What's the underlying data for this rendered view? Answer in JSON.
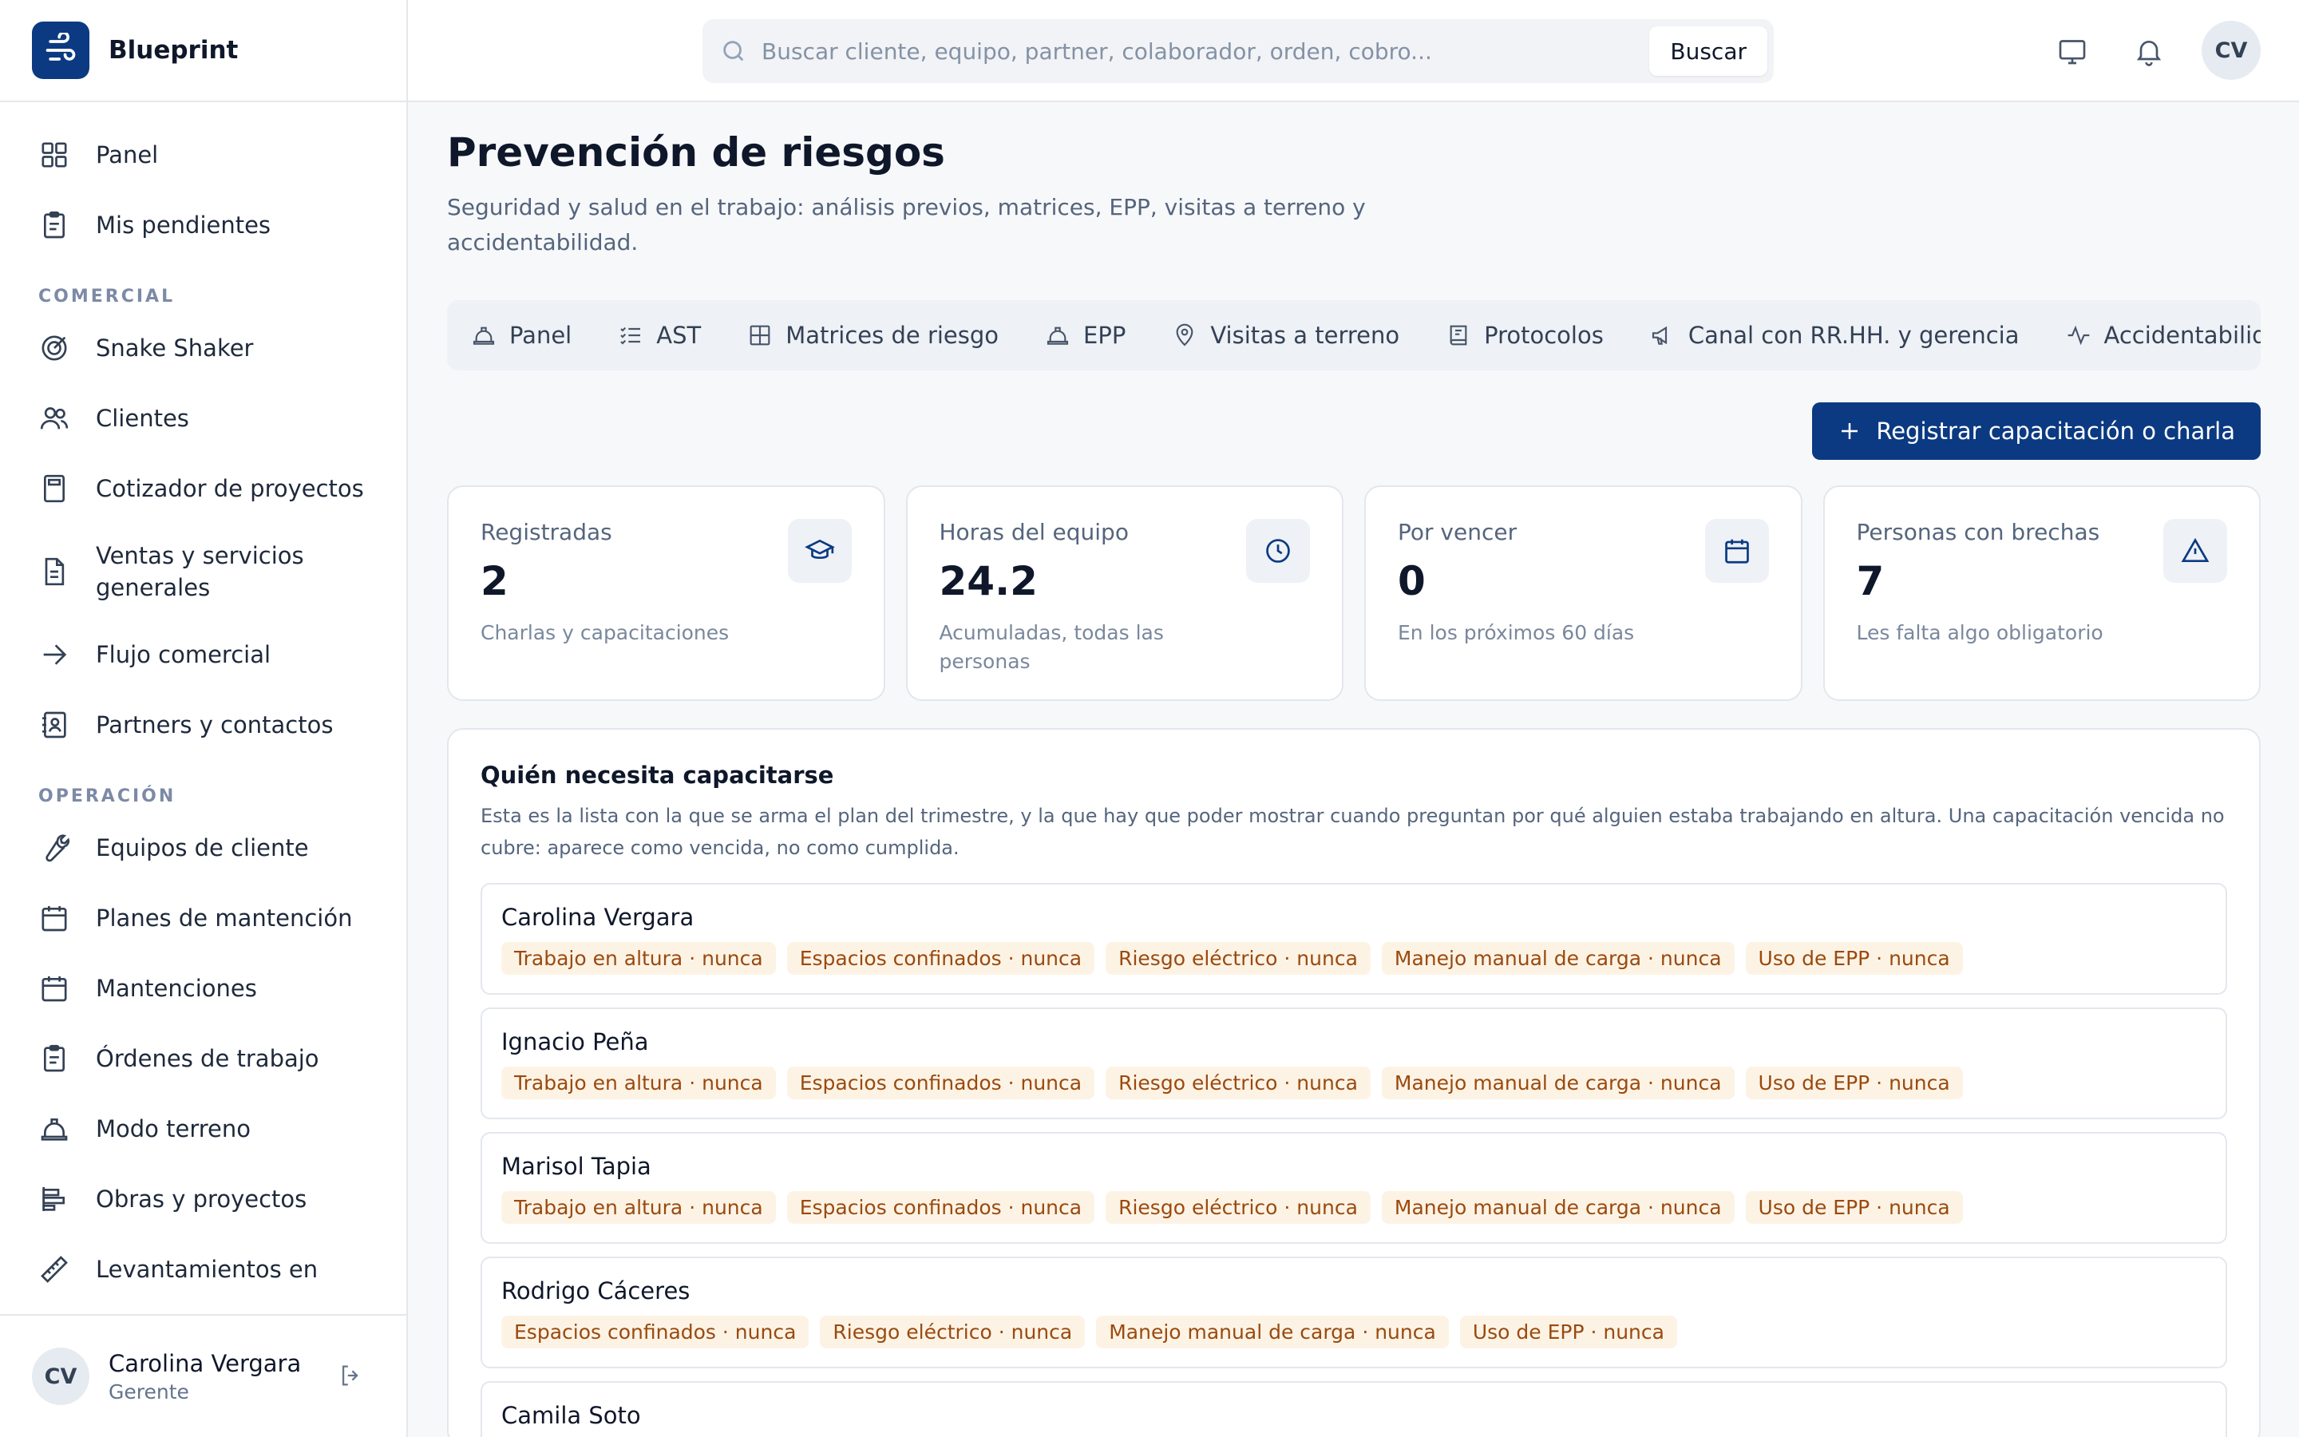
{
  "app": {
    "name": "Blueprint"
  },
  "sidebar": {
    "top_items": [
      {
        "label": "Panel",
        "icon": "grid-icon"
      },
      {
        "label": "Mis pendientes",
        "icon": "clipboard-icon"
      }
    ],
    "sections": [
      {
        "title": "COMERCIAL",
        "items": [
          {
            "label": "Snake Shaker",
            "icon": "target-icon"
          },
          {
            "label": "Clientes",
            "icon": "users-icon"
          },
          {
            "label": "Cotizador de proyectos",
            "icon": "calculator-icon"
          },
          {
            "label": "Ventas y servicios generales",
            "icon": "document-icon"
          },
          {
            "label": "Flujo comercial",
            "icon": "arrow-right-icon"
          },
          {
            "label": "Partners y contactos",
            "icon": "contact-book-icon"
          }
        ]
      },
      {
        "title": "OPERACIÓN",
        "items": [
          {
            "label": "Equipos de cliente",
            "icon": "wrench-icon"
          },
          {
            "label": "Planes de mantención",
            "icon": "calendar-grid-icon"
          },
          {
            "label": "Mantenciones",
            "icon": "calendar-dot-icon"
          },
          {
            "label": "Órdenes de trabajo",
            "icon": "clipboard-icon"
          },
          {
            "label": "Modo terreno",
            "icon": "hard-hat-icon"
          },
          {
            "label": "Obras y proyectos",
            "icon": "gantt-icon"
          },
          {
            "label": "Levantamientos en",
            "icon": "ruler-icon"
          }
        ]
      }
    ],
    "user": {
      "initials": "CV",
      "name": "Carolina Vergara",
      "role": "Gerente"
    }
  },
  "topbar": {
    "search_placeholder": "Buscar cliente, equipo, partner, colaborador, orden, cobro...",
    "search_button": "Buscar",
    "avatar_initials": "CV"
  },
  "page": {
    "title": "Prevención de riesgos",
    "subtitle": "Seguridad y salud en el trabajo: análisis previos, matrices, EPP, visitas a terreno y accidentabilidad."
  },
  "tabs": [
    {
      "label": "Panel",
      "icon": "hard-hat-icon"
    },
    {
      "label": "AST",
      "icon": "checklist-icon"
    },
    {
      "label": "Matrices de riesgo",
      "icon": "table-grid-icon"
    },
    {
      "label": "EPP",
      "icon": "hard-hat-icon"
    },
    {
      "label": "Visitas a terreno",
      "icon": "map-pin-icon"
    },
    {
      "label": "Protocolos",
      "icon": "book-icon"
    },
    {
      "label": "Canal con RR.HH. y gerencia",
      "icon": "megaphone-icon"
    },
    {
      "label": "Accidentabilidad",
      "icon": "activity-icon"
    }
  ],
  "primary_action": {
    "label": "Registrar capacitación o charla"
  },
  "stats": [
    {
      "label": "Registradas",
      "value": "2",
      "desc": "Charlas y capacitaciones",
      "icon": "graduation-cap-icon"
    },
    {
      "label": "Horas del equipo",
      "value": "24.2",
      "desc": "Acumuladas, todas las personas",
      "icon": "clock-icon"
    },
    {
      "label": "Por vencer",
      "value": "0",
      "desc": "En los próximos 60 días",
      "icon": "calendar-icon"
    },
    {
      "label": "Personas con brechas",
      "value": "7",
      "desc": "Les falta algo obligatorio",
      "icon": "alert-triangle-icon"
    }
  ],
  "training_list": {
    "title": "Quién necesita capacitarse",
    "description": "Esta es la lista con la que se arma el plan del trimestre, y la que hay que poder mostrar cuando preguntan por qué alguien estaba trabajando en altura. Una capacitación vencida no cubre: aparece como vencida, no como cumplida.",
    "people": [
      {
        "name": "Carolina Vergara",
        "gaps": [
          "Trabajo en altura · nunca",
          "Espacios confinados · nunca",
          "Riesgo eléctrico · nunca",
          "Manejo manual de carga · nunca",
          "Uso de EPP · nunca"
        ]
      },
      {
        "name": "Ignacio Peña",
        "gaps": [
          "Trabajo en altura · nunca",
          "Espacios confinados · nunca",
          "Riesgo eléctrico · nunca",
          "Manejo manual de carga · nunca",
          "Uso de EPP · nunca"
        ]
      },
      {
        "name": "Marisol Tapia",
        "gaps": [
          "Trabajo en altura · nunca",
          "Espacios confinados · nunca",
          "Riesgo eléctrico · nunca",
          "Manejo manual de carga · nunca",
          "Uso de EPP · nunca"
        ]
      },
      {
        "name": "Rodrigo Cáceres",
        "gaps": [
          "Espacios confinados · nunca",
          "Riesgo eléctrico · nunca",
          "Manejo manual de carga · nunca",
          "Uso de EPP · nunca"
        ]
      },
      {
        "name": "Camila Soto",
        "gaps": []
      }
    ]
  },
  "colors": {
    "brand": "#0b3a82",
    "chip_bg": "#fdf3e5",
    "chip_text": "#9a4a0f"
  }
}
